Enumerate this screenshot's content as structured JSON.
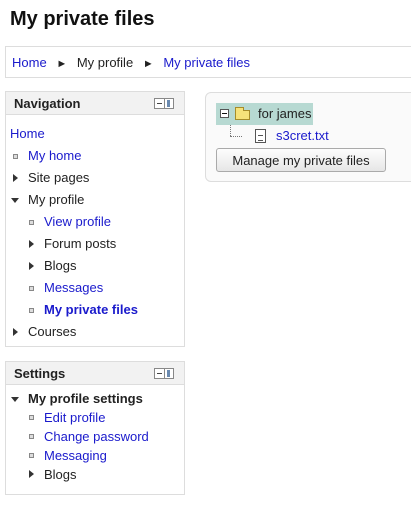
{
  "page": {
    "title": "My private files"
  },
  "breadcrumb": {
    "items": [
      {
        "label": "Home",
        "link": true
      },
      {
        "label": "My profile",
        "link": false
      },
      {
        "label": "My private files",
        "link": true
      }
    ],
    "separator": "►"
  },
  "navigation": {
    "title": "Navigation",
    "home": "Home",
    "my_home": "My home",
    "site_pages": "Site pages",
    "my_profile": "My profile",
    "view_profile": "View profile",
    "forum_posts": "Forum posts",
    "blogs": "Blogs",
    "messages": "Messages",
    "my_private_files": "My private files",
    "courses": "Courses"
  },
  "settings": {
    "title": "Settings",
    "my_profile_settings": "My profile settings",
    "edit_profile": "Edit profile",
    "change_password": "Change password",
    "messaging": "Messaging",
    "blogs": "Blogs"
  },
  "files": {
    "folder_name": "for james",
    "file_name": "s3cret.txt",
    "manage_button": "Manage my private files"
  },
  "colors": {
    "link": "#1a1acc",
    "folder_highlight": "#b7d9d2"
  }
}
